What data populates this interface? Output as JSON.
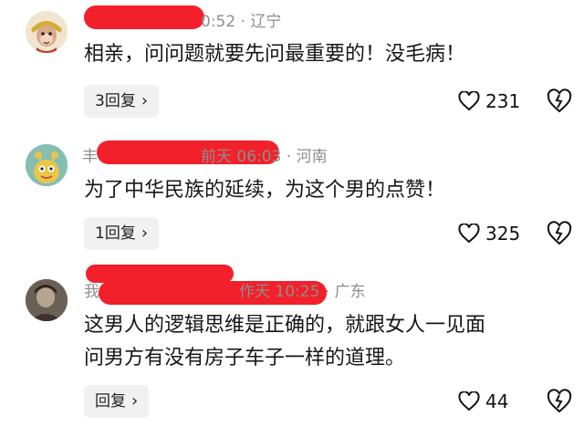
{
  "comments": [
    {
      "time_location": "0:52 · 辽宁",
      "text_lines": [
        "相亲，问问题就要先问最重要的！没毛病！"
      ],
      "reply_label": "3回复",
      "likes": "231",
      "icons": {
        "avatar": "monkey-king-avatar",
        "like": "heart-icon",
        "dislike": "broken-heart-icon",
        "reply": "chevron-right-icon"
      }
    },
    {
      "name_initial": "丰",
      "time_location": "前天 06:03 · 河南",
      "text_lines": [
        "为了中华民族的延续，为这个男的点赞！"
      ],
      "reply_label": "1回复",
      "likes": "325",
      "icons": {
        "avatar": "green-monster-avatar",
        "like": "heart-icon",
        "dislike": "broken-heart-icon",
        "reply": "chevron-right-icon"
      }
    },
    {
      "name_prefix": "我",
      "time_location": "作天 10:25 · 广东",
      "text_lines": [
        "这男人的逻辑思维是正确的，就跟女人一见面",
        "问男方有没有房子车子一样的道理。"
      ],
      "reply_label": "回复",
      "likes": "44",
      "icons": {
        "avatar": "photo-avatar",
        "like": "heart-icon",
        "dislike": "broken-heart-icon",
        "reply": "chevron-right-icon"
      }
    }
  ],
  "colors": {
    "redaction": "#f2202a",
    "meta_text": "#8e8e8e",
    "reply_bg": "#f1f1f1"
  }
}
